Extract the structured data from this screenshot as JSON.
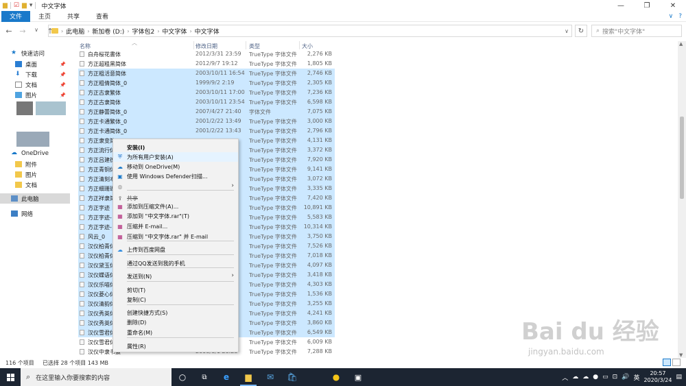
{
  "window": {
    "title": "中文字体",
    "minimize": "—",
    "maximize": "❐",
    "close": "✕"
  },
  "ribbon": {
    "tabs": [
      "文件",
      "主页",
      "共享",
      "查看"
    ],
    "collapse": "∨",
    "help": "?"
  },
  "address": {
    "path": [
      "此电脑",
      "新加卷 (D:)",
      "字体包2",
      "中文字体",
      "中文字体"
    ],
    "search_placeholder": "搜索\"中文字体\""
  },
  "sidebar": {
    "quick_access": "快速访问",
    "items": [
      "桌面",
      "下载",
      "文档",
      "图片"
    ],
    "onedrive": "OneDrive",
    "onedrive_items": [
      "附件",
      "图片",
      "文档"
    ],
    "this_pc": "此电脑",
    "network": "网络"
  },
  "columns": {
    "name": "名称",
    "date": "修改日期",
    "type": "类型",
    "size": "大小"
  },
  "files": [
    {
      "name": "白舟桜花書体",
      "date": "2012/3/31 23:59",
      "type": "TrueType 字体文件",
      "size": "2,276 KB",
      "sel": false
    },
    {
      "name": "方正超粗黑简体",
      "date": "2012/9/7 19:12",
      "type": "TrueType 字体文件",
      "size": "1,805 KB",
      "sel": false
    },
    {
      "name": "方正粗活意简体",
      "date": "2003/10/11 16:54",
      "type": "TrueType 字体文件",
      "size": "2,746 KB",
      "sel": true
    },
    {
      "name": "方正粗倩简体_0",
      "date": "1999/9/2 2:19",
      "type": "TrueType 字体文件",
      "size": "2,305 KB",
      "sel": true
    },
    {
      "name": "方正古隶繁体",
      "date": "2003/10/11 17:00",
      "type": "TrueType 字体文件",
      "size": "7,236 KB",
      "sel": true
    },
    {
      "name": "方正古隶简体",
      "date": "2003/10/11 23:54",
      "type": "TrueType 字体文件",
      "size": "6,598 KB",
      "sel": true
    },
    {
      "name": "方正静蕾简体_0",
      "date": "2007/4/27 21:40",
      "type": "字体文件",
      "size": "7,075 KB",
      "sel": true
    },
    {
      "name": "方正卡通繁体_0",
      "date": "2001/2/22 13:49",
      "type": "TrueType 字体文件",
      "size": "3,000 KB",
      "sel": true
    },
    {
      "name": "方正卡通简体_0",
      "date": "2001/2/22 13:43",
      "type": "TrueType 字体文件",
      "size": "2,796 KB",
      "sel": true
    },
    {
      "name": "方正隶变简",
      "date": "",
      "type": "TrueType 字体文件",
      "size": "4,131 KB",
      "sel": true
    },
    {
      "name": "方正流行体",
      "date": "",
      "type": "TrueType 字体文件",
      "size": "3,372 KB",
      "sel": true
    },
    {
      "name": "方正吕建德",
      "date": "",
      "type": "TrueType 字体文件",
      "size": "7,920 KB",
      "sel": true
    },
    {
      "name": "方正青铜体",
      "date": "",
      "type": "TrueType 字体文件",
      "size": "9,141 KB",
      "sel": true
    },
    {
      "name": "方正清刻本",
      "date": "",
      "type": "TrueType 字体文件",
      "size": "3,072 KB",
      "sel": true
    },
    {
      "name": "方正细珊瑚",
      "date": "",
      "type": "TrueType 字体文件",
      "size": "3,335 KB",
      "sel": true
    },
    {
      "name": "方正祥隶简",
      "date": "",
      "type": "TrueType 字体文件",
      "size": "7,420 KB",
      "sel": true
    },
    {
      "name": "方正字迹",
      "date": "",
      "type": "TrueType 字体文件",
      "size": "10,891 KB",
      "sel": true
    },
    {
      "name": "方正字迹-",
      "date": "",
      "type": "TrueType 字体文件",
      "size": "5,583 KB",
      "sel": true
    },
    {
      "name": "方正字迹-",
      "date": "",
      "type": "TrueType 字体文件",
      "size": "10,314 KB",
      "sel": true
    },
    {
      "name": "风云_0",
      "date": "",
      "type": "TrueType 字体文件",
      "size": "3,750 KB",
      "sel": true
    },
    {
      "name": "汉仪柏青体",
      "date": "",
      "type": "TrueType 字体文件",
      "size": "7,526 KB",
      "sel": true
    },
    {
      "name": "汉仪柏青体",
      "date": "",
      "type": "TrueType 字体文件",
      "size": "7,018 KB",
      "sel": true
    },
    {
      "name": "汉仪黛玉体",
      "date": "",
      "type": "TrueType 字体文件",
      "size": "4,097 KB",
      "sel": true
    },
    {
      "name": "汉仪蝶语体",
      "date": "",
      "type": "TrueType 字体文件",
      "size": "3,418 KB",
      "sel": true
    },
    {
      "name": "汉仪乐喵体",
      "date": "",
      "type": "TrueType 字体文件",
      "size": "4,303 KB",
      "sel": true
    },
    {
      "name": "汉仪菱心体",
      "date": "",
      "type": "TrueType 字体文件",
      "size": "1,536 KB",
      "sel": true
    },
    {
      "name": "汉仪清韵体",
      "date": "",
      "type": "TrueType 字体文件",
      "size": "3,255 KB",
      "sel": true
    },
    {
      "name": "汉仪秀英体",
      "date": "",
      "type": "TrueType 字体文件",
      "size": "4,241 KB",
      "sel": true
    },
    {
      "name": "汉仪秀英体",
      "date": "",
      "type": "TrueType 字体文件",
      "size": "3,860 KB",
      "sel": true
    },
    {
      "name": "汉仪雪君体",
      "date": "",
      "type": "TrueType 字体文件",
      "size": "6,549 KB",
      "sel": true
    },
    {
      "name": "汉仪雪君体",
      "date": "",
      "type": "TrueType 字体文件",
      "size": "6,009 KB",
      "sel": false
    },
    {
      "name": "汉仪中隶书繁",
      "date": "2008/6/1 20:23",
      "type": "TrueType 字体文件",
      "size": "7,288 KB",
      "sel": false
    }
  ],
  "context_menu": [
    {
      "label": "安装(I)",
      "icon": "",
      "bold": true
    },
    {
      "label": "为所有用户安装(A)",
      "icon": "shield",
      "hover": true
    },
    {
      "label": "移动到 OneDrive(M)",
      "icon": "cloud"
    },
    {
      "label": "使用 Windows Defender扫描...",
      "icon": "defender"
    },
    {
      "label": "",
      "icon": "share-blur",
      "arrow": true
    },
    {
      "label": "共享",
      "icon": "share",
      "strike": true
    },
    {
      "label": "添加到压缩文件(A)...",
      "icon": "rar"
    },
    {
      "label": "添加到 \"中文字体.rar\"(T)",
      "icon": "rar"
    },
    {
      "label": "压缩并 E-mail...",
      "icon": "rar"
    },
    {
      "label": "压缩到 \"中文字体.rar\" 并 E-mail",
      "icon": "rar"
    },
    {
      "label": "上传到百度网盘",
      "icon": "baidu"
    },
    {
      "label": "通过QQ发送到我的手机",
      "icon": ""
    },
    {
      "label": "发送到(N)",
      "icon": "",
      "arrow": true
    },
    {
      "label": "剪切(T)",
      "icon": ""
    },
    {
      "label": "复制(C)",
      "icon": ""
    },
    {
      "label": "创建快捷方式(S)",
      "icon": ""
    },
    {
      "label": "删除(D)",
      "icon": ""
    },
    {
      "label": "重命名(M)",
      "icon": ""
    },
    {
      "label": "属性(R)",
      "icon": ""
    }
  ],
  "status": {
    "count": "116 个项目",
    "selected": "已选择 28 个项目  143 MB"
  },
  "taskbar": {
    "search": "在这里输入你要搜索的内容",
    "ime": "英",
    "time": "20:57",
    "date": "2020/3/24"
  },
  "watermark": {
    "text": "Bai du 经验",
    "url": "jingyan.baidu.com"
  },
  "colors": {
    "accent": "#1979ca",
    "selection": "#cce8ff",
    "taskbar": "#1c2532"
  }
}
